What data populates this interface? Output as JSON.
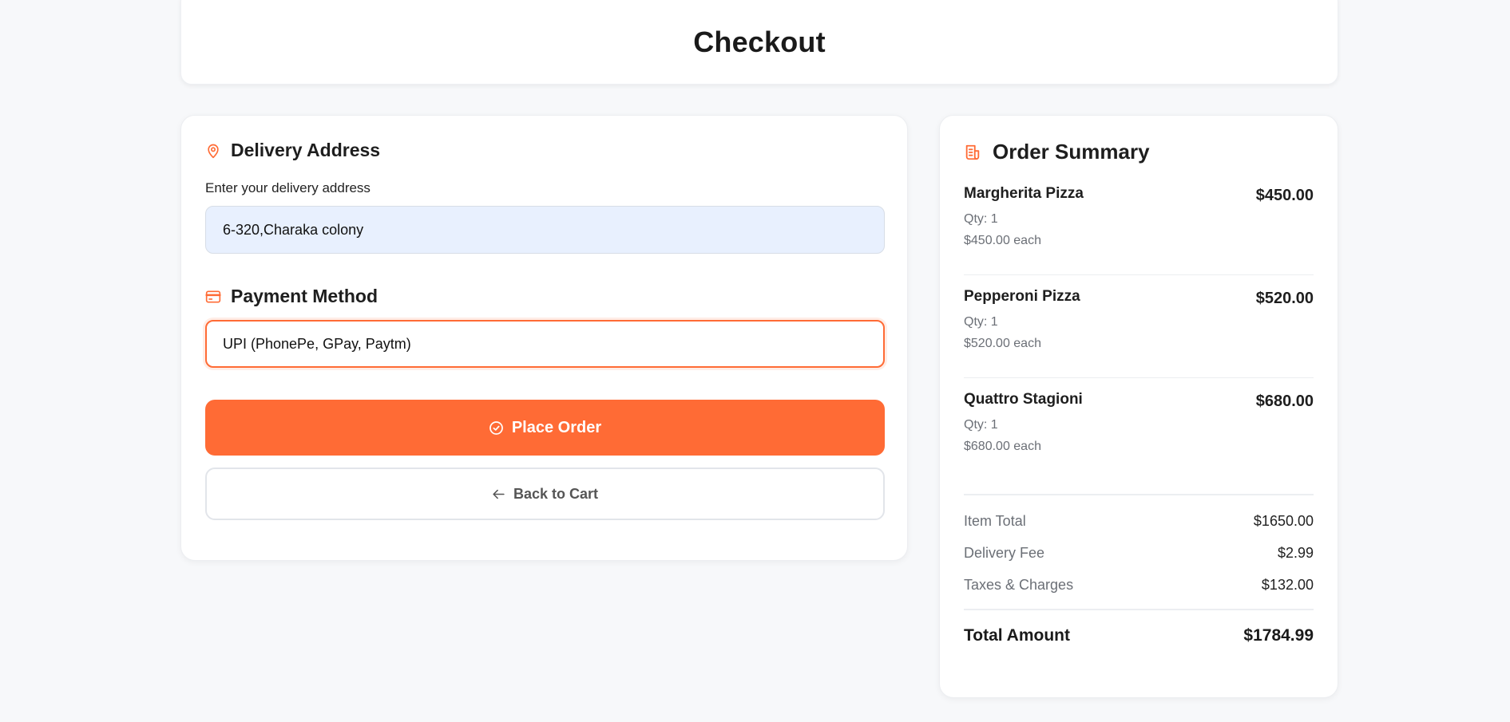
{
  "page": {
    "title": "Checkout"
  },
  "delivery": {
    "title": "Delivery Address",
    "icon": "map-pin-icon",
    "field_label": "Enter your delivery address",
    "address_value": "6-320,Charaka colony"
  },
  "payment": {
    "title": "Payment Method",
    "icon": "credit-card-icon",
    "selected": "UPI (PhonePe, GPay, Paytm)"
  },
  "actions": {
    "place_order": "Place Order",
    "back_to_cart": "Back to Cart"
  },
  "summary": {
    "title": "Order Summary",
    "icon": "receipt-icon",
    "items": [
      {
        "name": "Margherita Pizza",
        "qty": "Qty: 1",
        "each": "$450.00 each",
        "price": "$450.00"
      },
      {
        "name": "Pepperoni Pizza",
        "qty": "Qty: 1",
        "each": "$520.00 each",
        "price": "$520.00"
      },
      {
        "name": "Quattro Stagioni",
        "qty": "Qty: 1",
        "each": "$680.00 each",
        "price": "$680.00"
      }
    ],
    "item_total_label": "Item Total",
    "item_total": "$1650.00",
    "delivery_fee_label": "Delivery Fee",
    "delivery_fee": "$2.99",
    "taxes_label": "Taxes & Charges",
    "taxes": "$132.00",
    "grand_total_label": "Total Amount",
    "grand_total": "$1784.99"
  },
  "colors": {
    "accent": "#ff6b35",
    "background": "#f7f8fa",
    "input_fill": "#e8f0fe"
  }
}
